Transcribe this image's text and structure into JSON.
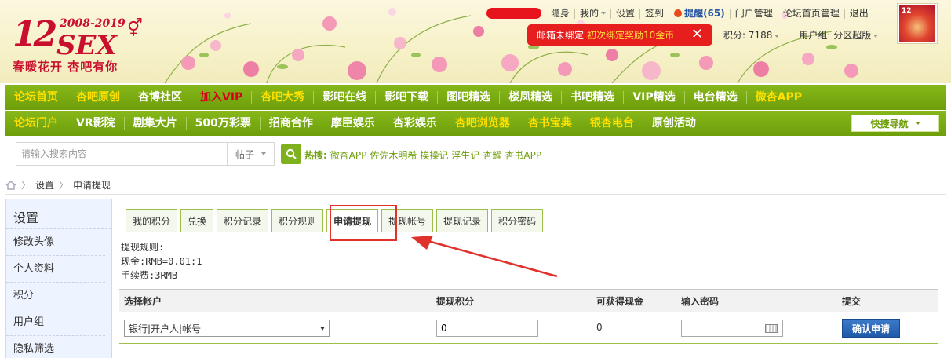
{
  "logo": {
    "years": "2008-2019",
    "num": "12",
    "brand": "SEX",
    "slogan": "春暖花开 杏吧有你"
  },
  "toplinks": [
    "隐身",
    "我的",
    "设置",
    "签到",
    "提醒(65)",
    "门户管理",
    "论坛首页管理",
    "退出"
  ],
  "mail_bar": {
    "text": "邮箱未绑定",
    "reward": "初次绑定奖励10金币",
    "close": "✕"
  },
  "user": {
    "points": "积分: 7188",
    "group": "用户组: 分区超版"
  },
  "nav1": [
    {
      "label": "论坛首页",
      "style": "hl"
    },
    {
      "label": "杏吧原创",
      "style": "hl"
    },
    {
      "label": "杏博社区",
      "style": ""
    },
    {
      "label": "加入VIP",
      "style": "red"
    },
    {
      "label": "杏吧大秀",
      "style": "hl"
    },
    {
      "label": "影吧在线",
      "style": ""
    },
    {
      "label": "影吧下载",
      "style": ""
    },
    {
      "label": "图吧精选",
      "style": ""
    },
    {
      "label": "楼凤精选",
      "style": ""
    },
    {
      "label": "书吧精选",
      "style": ""
    },
    {
      "label": "VIP精选",
      "style": ""
    },
    {
      "label": "电台精选",
      "style": ""
    },
    {
      "label": "微杏APP",
      "style": "hl"
    }
  ],
  "nav2": [
    {
      "label": "论坛门户",
      "style": "hl"
    },
    {
      "label": "VR影院",
      "style": ""
    },
    {
      "label": "剧集大片",
      "style": ""
    },
    {
      "label": "500万彩票",
      "style": ""
    },
    {
      "label": "招商合作",
      "style": ""
    },
    {
      "label": "摩臣娱乐",
      "style": ""
    },
    {
      "label": "杏彩娱乐",
      "style": ""
    },
    {
      "label": "杏吧浏览器",
      "style": "hl"
    },
    {
      "label": "杏书宝典",
      "style": "hl"
    },
    {
      "label": "银杏电台",
      "style": "hl"
    },
    {
      "label": "原创活动",
      "style": ""
    }
  ],
  "quick_nav": "快捷导航",
  "search": {
    "placeholder": "请输入搜索内容",
    "scope": "帖子",
    "hot_label": "热搜:",
    "hot_words": [
      "微杏APP",
      "佐佐木明希",
      "挨操记",
      "浮生记",
      "杏耀",
      "杏书APP"
    ]
  },
  "breadcrumb": [
    "设置",
    "申请提现"
  ],
  "sidebar": {
    "title": "设置",
    "items": [
      "修改头像",
      "个人资料",
      "积分",
      "用户组",
      "隐私筛选"
    ]
  },
  "tabs": [
    "我的积分",
    "兑换",
    "积分记录",
    "积分规则",
    "申请提现",
    "提现帐号",
    "提现记录",
    "积分密码"
  ],
  "active_tab": 4,
  "rules": [
    "提现规则:",
    "现金:RMB=0.01:1",
    "手续费:3RMB"
  ],
  "table": {
    "headers": [
      "选择帐户",
      "提现积分",
      "可获得现金",
      "输入密码",
      "提交"
    ],
    "account_select": "银行|开户人|帐号",
    "points_value": "0",
    "cash_value": "0",
    "submit_label": "确认申请"
  },
  "colors": {
    "nav_green": "#7aab12",
    "highlight_red": "#e0302a",
    "link_blue": "#2a57a5"
  }
}
